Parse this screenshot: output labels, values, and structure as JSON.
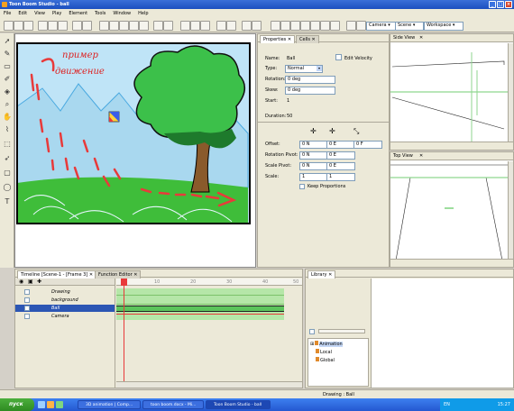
{
  "window": {
    "title": "Toon Boom Studio - ball"
  },
  "menu": [
    "File",
    "Edit",
    "View",
    "Play",
    "Element",
    "Tools",
    "Window",
    "Help"
  ],
  "toolbar": {
    "camera_label": "Camera",
    "scene_label": "Scene",
    "workspace_label": "Workspace"
  },
  "canvas": {
    "annotation_line1": "пример",
    "annotation_line2": "движение"
  },
  "properties": {
    "tab_properties": "Properties",
    "tab_cells": "Cells",
    "name_label": "Name:",
    "name_value": "Ball",
    "type_label": "Type:",
    "type_value": "Normal",
    "rotation_label": "Rotation:",
    "rotation_value": "0 deg",
    "skew_label": "Skew:",
    "skew_value": "0 deg",
    "start_label": "Start:",
    "start_value": "1",
    "duration_label": "Duration:",
    "duration_value": "50",
    "edit_velocity": "Edit Velocity",
    "offset_label": "Offset:",
    "offset_n": "0 N",
    "offset_e": "0 E",
    "offset_f": "0 F",
    "rotpivot_label": "Rotation Pivot:",
    "rotpivot_n": "0 N",
    "rotpivot_e": "0 E",
    "scalepivot_label": "Scale Pivot:",
    "scalepivot_n": "0 N",
    "scalepivot_e": "0 E",
    "scale_label": "Scale:",
    "scale_x": "1",
    "scale_y": "1",
    "keep_proportions": "Keep Proportions"
  },
  "sideview": {
    "title": "Side View"
  },
  "topview": {
    "title": "Top View"
  },
  "timeline": {
    "tab_timeline": "Timeline [Scene-1 - [Frame 3]",
    "tab_function": "Function Editor",
    "ruler": [
      "10",
      "20",
      "30",
      "40",
      "50"
    ],
    "layers": [
      "Drawing",
      "background",
      "Ball",
      "Camera"
    ]
  },
  "library": {
    "tab": "Library",
    "tree": [
      "Animation",
      "Local",
      "Global"
    ]
  },
  "status": {
    "text": "Drawing : Ball"
  },
  "taskbar": {
    "start": "пуск",
    "tasks": [
      "3D animation | Comp...",
      "toon boom.docx - Mi...",
      "Toon Boom Studio - ball"
    ],
    "lang": "EN",
    "clock": "15:27"
  },
  "colors": {
    "sky_blue": "#9fd6f2",
    "grass": "#3fbd3a",
    "tree": "#2ea53c",
    "ball_red": "#e83a3a",
    "selection": "#2c56b4"
  }
}
